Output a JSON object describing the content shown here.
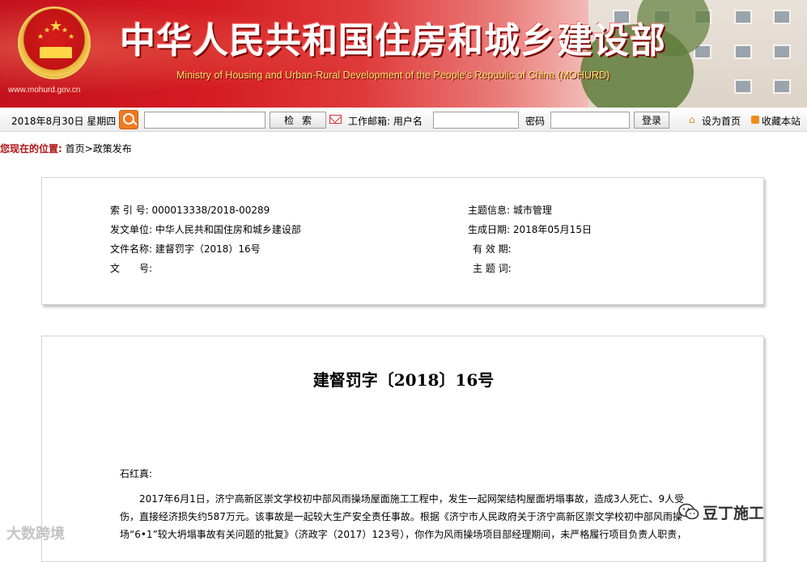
{
  "banner": {
    "title": "中华人民共和国住房和城乡建设部",
    "subtitle": "Ministry of Housing and Urban-Rural Development of the People's Republic of China (MOHURD)",
    "url": "www.mohurd.gov.cn"
  },
  "toolbar": {
    "date": "2018年8月30日 星期四",
    "search_button": "检索",
    "mail_label": "工作邮箱: 用户名",
    "password_label": "密码",
    "login_button": "登录",
    "set_home": "设为首页",
    "bookmark": "收藏本站"
  },
  "breadcrumb": {
    "label": "您现在的位置:",
    "path": "首页>政策发布"
  },
  "meta": {
    "index_no_label": "索 引 号:",
    "index_no": "000013338/2018-00289",
    "issuer_label": "发文单位:",
    "issuer": "中华人民共和国住房和城乡建设部",
    "file_name_label": "文件名称:",
    "file_name": "建督罚字（2018）16号",
    "doc_no_label": "文　　号:",
    "doc_no": "",
    "topic_label": "主题信息:",
    "topic": "城市管理",
    "date_label": "生成日期:",
    "date": "2018年05月15日",
    "valid_label": "有 效 期:",
    "valid": "",
    "keywords_label": "主 题 词:",
    "keywords": ""
  },
  "document": {
    "title": "建督罚字〔2018〕16号",
    "addressee": "石红真:",
    "paragraph": "2017年6月1日，济宁高新区崇文学校初中部风雨操场屋面施工工程中，发生一起网架结构屋面坍塌事故，造成3人死亡、9人受伤，直接经济损失约587万元。该事故是一起较大生产安全责任事故。根据《济宁市人民政府关于济宁高新区崇文学校初中部风雨操场“6•1”较大坍塌事故有关问题的批复》（济政字（2017）123号），你作为风雨操场项目部经理期间，未严格履行项目负责人职责，"
  },
  "watermarks": {
    "left": "大数跨境",
    "right": "豆丁施工"
  },
  "colors": {
    "banner_red": "#c4111d",
    "banner_gold": "#f7e36a",
    "breadcrumb_label": "#b01515",
    "search_orange": "#ef7a22"
  }
}
